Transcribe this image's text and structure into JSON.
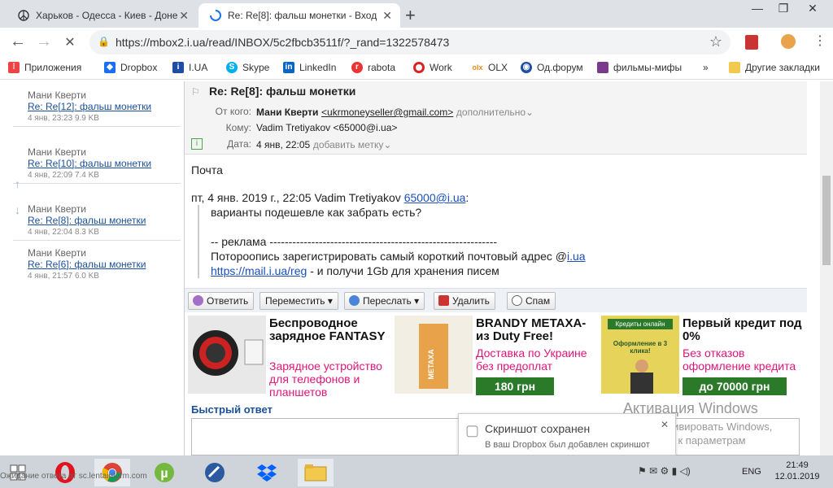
{
  "browser": {
    "tabs": [
      {
        "title": "Харьков - Одесса - Киев - Доне"
      },
      {
        "title": "Re: Re[8]: фальш монетки - Вход"
      }
    ],
    "url": "https://mbox2.i.ua/read/INBOX/5c2fbcb3511f/?_rand=1322578473",
    "bookmarks": [
      "Приложения",
      "Dropbox",
      "I.UA",
      "Skype",
      "LinkedIn",
      "rabota",
      "Work",
      "OLX",
      "Од.форум",
      "фильмы-мифы"
    ],
    "other_bookmarks": "Другие закладки",
    "more": "»"
  },
  "message_list": [
    {
      "from": "Мани Кверти",
      "subject": "Re: Re[12]: фальш монетки",
      "meta": "4 янв, 23:23 9.9 KB"
    },
    {
      "from": "Мани Кверти",
      "subject": "Re: Re[10]: фальш монетки",
      "meta": "4 янв, 22:09 7.4 KB"
    },
    {
      "from": "Мани Кверти",
      "subject": "Re: Re[8]: фальш монетки",
      "meta": "4 янв, 22:04 8.3 KB"
    },
    {
      "from": "Мани Кверти",
      "subject": "Re: Re[6]: фальш монетки",
      "meta": "4 янв, 21:57 6.0 KB"
    }
  ],
  "message": {
    "subject": "Re: Re[8]: фальш монетки",
    "from_label": "От кого:",
    "from_name": "Мани Кверти",
    "from_email": "<ukrmoneyseller@gmail.com>",
    "more_link": "дополнительно",
    "to_label": "Кому:",
    "to_value": "Vadim Tretiyakov <65000@i.ua>",
    "date_label": "Дата:",
    "date_value": "4 янв, 22:05",
    "add_tag": "добавить метку",
    "body_line1": "Почта",
    "quote_header_prefix": "пт, 4 янв. 2019 г., 22:05 Vadim Tretiyakov",
    "quote_header_email": "65000@i.ua",
    "quote_header_suffix": ":",
    "quote_line1": "варианты подешевле как забрать есть?",
    "quote_line2": "-- реклама ------------------------------------------------------------",
    "quote_line3_prefix": "Потороопись зарегистрировать самый короткий почтовый адрес @",
    "quote_line3_link": "i.ua",
    "quote_line4_link": "https://mail.i.ua/reg",
    "quote_line4_suffix": " - и получи 1Gb для хранения писем"
  },
  "actions": {
    "reply": "Ответить",
    "move": "Переместить",
    "forward": "Переслать",
    "delete": "Удалить",
    "spam": "Спам"
  },
  "ads": [
    {
      "title": "Беспроводное зарядное FANTASY",
      "text": "Зарядное устройство для телефонов и планшетов"
    },
    {
      "title": "BRANDY METAXA-из Duty Free!",
      "text": "Доставка по Украине без предоплат",
      "price": "180 грн",
      "img_text": "METAXA"
    },
    {
      "title": "Первый кредит под 0%",
      "text": "Без отказов оформление кредита",
      "price": "до 70000 грн",
      "img_text_1": "Кредиты онлайн",
      "img_text_2": "Оформление в 3 клика!"
    }
  ],
  "quick_reply": {
    "label": "Быстрый ответ"
  },
  "windows_activation": {
    "title": "Активация Windows",
    "text": "Чтобы активировать Windows, перейдите к параметрам"
  },
  "toast": {
    "title": "Скриншот сохранен",
    "text": "В ваш Dropbox был добавлен скриншот"
  },
  "taskbar": {
    "status": "Ожидание ответа от sc.lentainform.com",
    "lang": "ENG",
    "time": "21:49",
    "date": "12.01.2019"
  },
  "colors": {
    "link": "#1a4f99",
    "ad_pink": "#e0147a",
    "price_green": "#2a7a2a"
  }
}
